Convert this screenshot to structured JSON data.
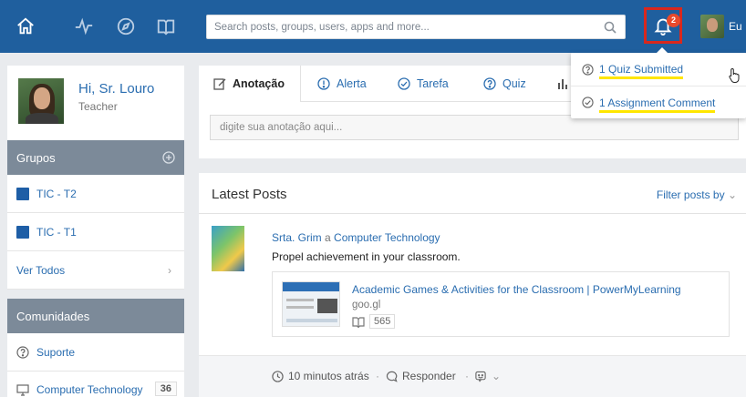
{
  "topbar": {
    "search_placeholder": "Search posts, groups, users, apps and more...",
    "notification_count": "2",
    "user_short_name": "Eu"
  },
  "profile": {
    "greeting": "Hi, Sr. Louro",
    "role": "Teacher"
  },
  "groups": {
    "header": "Grupos",
    "items": [
      {
        "name": "TIC - T2"
      },
      {
        "name": "TIC - T1"
      }
    ],
    "see_all": "Ver Todos"
  },
  "communities": {
    "header": "Comunidades",
    "items": [
      {
        "name": "Suporte"
      },
      {
        "name": "Computer Technology",
        "count": "36"
      }
    ]
  },
  "composer": {
    "tabs": [
      {
        "label": "Anotação",
        "icon": "edit-icon"
      },
      {
        "label": "Alerta",
        "icon": "alert-icon"
      },
      {
        "label": "Tarefa",
        "icon": "check-circle-icon"
      },
      {
        "label": "Quiz",
        "icon": "question-circle-icon"
      }
    ],
    "placeholder": "digite sua anotação aqui..."
  },
  "posts": {
    "title": "Latest Posts",
    "filter_label": "Filter posts by",
    "items": [
      {
        "author": "Srta. Grim",
        "connector": "a",
        "target": "Computer Technology",
        "text": "Propel achievement in your classroom.",
        "link_title": "Academic Games & Activities for the Classroom | PowerMyLearning",
        "link_domain": "goo.gl",
        "link_count": "565",
        "time": "10 minutos atrás",
        "reply_label": "Responder"
      }
    ]
  },
  "notifications": {
    "items": [
      {
        "label": "1 Quiz Submitted",
        "icon": "question-circle-icon"
      },
      {
        "label": "1 Assignment Comment",
        "icon": "check-circle-icon"
      }
    ]
  },
  "colors": {
    "topbar": "#1f5f9e",
    "link": "#2a6db0",
    "highlight_box": "#d9281d",
    "underline_highlight": "#ffe600"
  }
}
